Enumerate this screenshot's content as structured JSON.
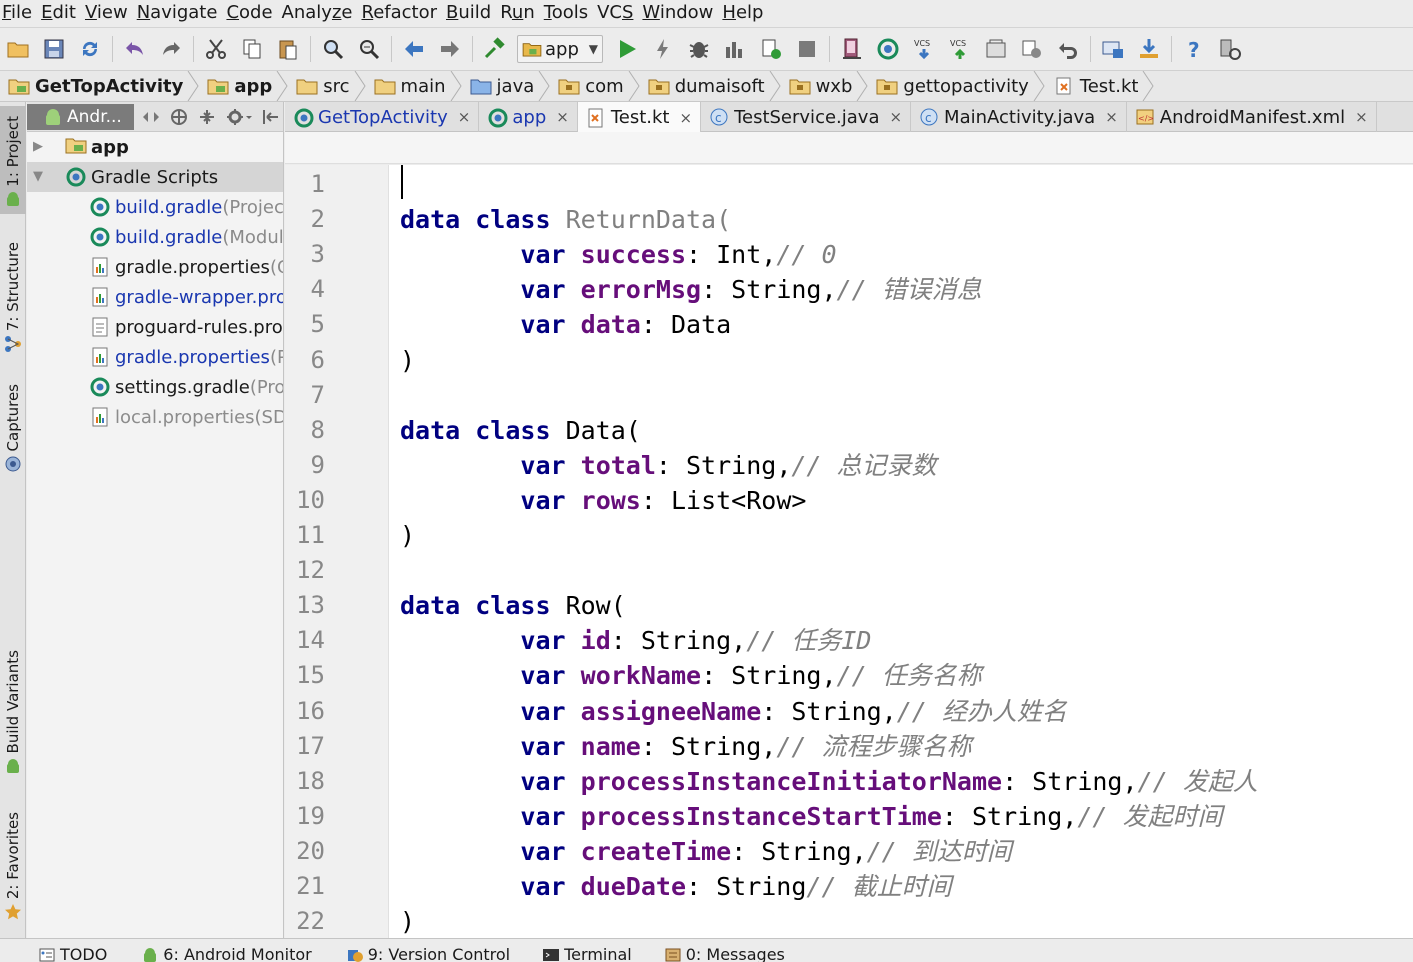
{
  "menu": {
    "items": [
      {
        "name": "menu-file",
        "mn": "F",
        "rest": "ile"
      },
      {
        "name": "menu-edit",
        "mn": "E",
        "rest": "dit"
      },
      {
        "name": "menu-view",
        "mn": "V",
        "rest": "iew"
      },
      {
        "name": "menu-navigate",
        "mn": "N",
        "rest": "avigate"
      },
      {
        "name": "menu-code",
        "mn": "C",
        "rest": "ode"
      },
      {
        "name": "menu-analyze",
        "pre": "Analy",
        "mn": "z",
        "rest": "e"
      },
      {
        "name": "menu-refactor",
        "mn": "R",
        "rest": "efactor"
      },
      {
        "name": "menu-build",
        "mn": "B",
        "rest": "uild"
      },
      {
        "name": "menu-run",
        "pre": "R",
        "mn": "u",
        "rest": "n"
      },
      {
        "name": "menu-tools",
        "mn": "T",
        "rest": "ools"
      },
      {
        "name": "menu-vcs",
        "pre": "VC",
        "mn": "S",
        "rest": ""
      },
      {
        "name": "menu-window",
        "mn": "W",
        "rest": "indow"
      },
      {
        "name": "menu-help",
        "mn": "H",
        "rest": "elp"
      }
    ]
  },
  "toolbar": {
    "run_config": "app"
  },
  "navbar": {
    "crumbs": [
      "GetTopActivity",
      "app",
      "src",
      "main",
      "java",
      "com",
      "dumaisoft",
      "wxb",
      "gettopactivity",
      "Test.kt"
    ]
  },
  "left_strip": {
    "project": "1: Project",
    "structure": "7: Structure",
    "captures": "Captures",
    "build_variants": "Build Variants",
    "favorites": "2: Favorites"
  },
  "project_panel": {
    "view_mode": "Andr...",
    "rows": [
      {
        "label": "app",
        "suffix": ""
      },
      {
        "label": "Gradle Scripts",
        "suffix": ""
      },
      {
        "label": "build.gradle",
        "suffix": " (Project"
      },
      {
        "label": "build.gradle",
        "suffix": " (Modul"
      },
      {
        "label": "gradle.properties",
        "suffix": " (G"
      },
      {
        "label": "gradle-wrapper.prop",
        "suffix": ""
      },
      {
        "label": "proguard-rules.pro",
        "suffix": " ("
      },
      {
        "label": "gradle.properties",
        "suffix": " (P"
      },
      {
        "label": "settings.gradle",
        "suffix": " (Proj"
      },
      {
        "label": "local.properties",
        "suffix": " (SDI"
      }
    ]
  },
  "editor_tabs": [
    {
      "label": "GetTopActivity",
      "close": "×"
    },
    {
      "label": "app",
      "close": "×"
    },
    {
      "label": "Test.kt",
      "close": "×"
    },
    {
      "label": "TestService.java",
      "close": "×"
    },
    {
      "label": "MainActivity.java",
      "close": "×"
    },
    {
      "label": "AndroidManifest.xml",
      "close": "×"
    }
  ],
  "code": {
    "line_numbers": [
      "1",
      "2",
      "3",
      "4",
      "5",
      "6",
      "7",
      "8",
      "9",
      "10",
      "11",
      "12",
      "13",
      "14",
      "15",
      "16",
      "17",
      "18",
      "19",
      "20",
      "21",
      "22"
    ],
    "lines": [
      {
        "ind": "",
        "kw": "",
        "prop": "",
        "text": "",
        "cm": ""
      },
      {
        "ind": "",
        "kw": "data class ",
        "prop": "",
        "text": "ReturnData(",
        "cm": "",
        "gray_name": true
      },
      {
        "ind": "        ",
        "kw": "var ",
        "prop": "success",
        "text": ": Int,",
        "cm": "// 0"
      },
      {
        "ind": "        ",
        "kw": "var ",
        "prop": "errorMsg",
        "text": ": String,",
        "cm": "// 错误消息"
      },
      {
        "ind": "        ",
        "kw": "var ",
        "prop": "data",
        "text": ": Data",
        "cm": ""
      },
      {
        "ind": "",
        "kw": "",
        "prop": "",
        "text": ")",
        "cm": ""
      },
      {
        "ind": "",
        "kw": "",
        "prop": "",
        "text": "",
        "cm": ""
      },
      {
        "ind": "",
        "kw": "data class ",
        "prop": "",
        "text": "Data(",
        "cm": ""
      },
      {
        "ind": "        ",
        "kw": "var ",
        "prop": "total",
        "text": ": String,",
        "cm": "// 总记录数"
      },
      {
        "ind": "        ",
        "kw": "var ",
        "prop": "rows",
        "text": ": List<Row>",
        "cm": ""
      },
      {
        "ind": "",
        "kw": "",
        "prop": "",
        "text": ")",
        "cm": ""
      },
      {
        "ind": "",
        "kw": "",
        "prop": "",
        "text": "",
        "cm": ""
      },
      {
        "ind": "",
        "kw": "data class ",
        "prop": "",
        "text": "Row(",
        "cm": ""
      },
      {
        "ind": "        ",
        "kw": "var ",
        "prop": "id",
        "text": ": String,",
        "cm": "// 任务ID"
      },
      {
        "ind": "        ",
        "kw": "var ",
        "prop": "workName",
        "text": ": String,",
        "cm": "// 任务名称"
      },
      {
        "ind": "        ",
        "kw": "var ",
        "prop": "assigneeName",
        "text": ": String,",
        "cm": "// 经办人姓名"
      },
      {
        "ind": "        ",
        "kw": "var ",
        "prop": "name",
        "text": ": String,",
        "cm": "// 流程步骤名称"
      },
      {
        "ind": "        ",
        "kw": "var ",
        "prop": "processInstanceInitiatorName",
        "text": ": String,",
        "cm": "// 发起人"
      },
      {
        "ind": "        ",
        "kw": "var ",
        "prop": "processInstanceStartTime",
        "text": ": String,",
        "cm": "// 发起时间"
      },
      {
        "ind": "        ",
        "kw": "var ",
        "prop": "createTime",
        "text": ": String,",
        "cm": "// 到达时间"
      },
      {
        "ind": "        ",
        "kw": "var ",
        "prop": "dueDate",
        "text": ": String",
        "cm": "// 截止时间"
      },
      {
        "ind": "",
        "kw": "",
        "prop": "",
        "text": ")",
        "cm": ""
      }
    ]
  },
  "bottom_bar": {
    "todo": "TODO",
    "android_monitor": "6: Android Monitor",
    "version_control": "9: Version Control",
    "terminal": "Terminal",
    "messages": "0: Messages"
  },
  "colors": {
    "keyword": "#000080",
    "property": "#660e7a",
    "comment": "#808080",
    "run_green": "#2f9b37"
  }
}
